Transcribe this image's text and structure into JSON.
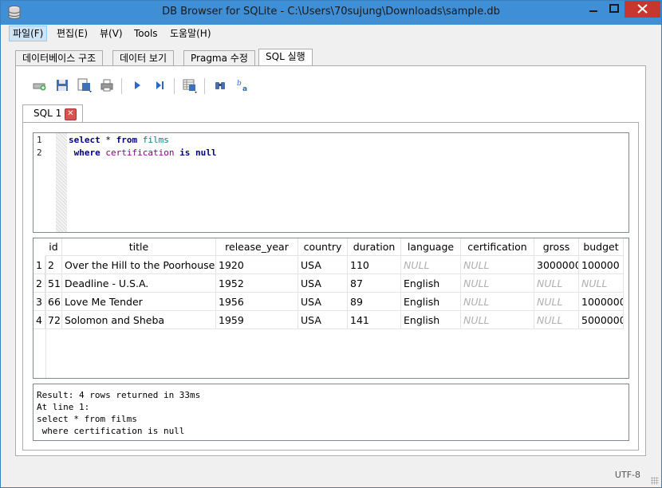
{
  "window": {
    "title": "DB Browser for SQLite - C:\\Users\\70sujung\\Downloads\\sample.db",
    "minimize": "—",
    "maximize": "□",
    "close": "✕"
  },
  "menu": [
    "파일(F)",
    "편집(E)",
    "뷰(V)",
    "Tools",
    "도움말(H)"
  ],
  "tabs": [
    "데이터베이스 구조",
    "데이터 보기",
    "Pragma 수정",
    "SQL 실행"
  ],
  "active_tab": "SQL 실행",
  "toolbar_icons": [
    "open-tab-icon",
    "open-sql-file-icon",
    "save-sql-file-icon",
    "print-icon",
    "execute-all-icon",
    "execute-line-icon",
    "save-results-icon",
    "find-icon",
    "find-replace-icon"
  ],
  "sql_tab": {
    "label": "SQL 1",
    "close": "✕"
  },
  "editor": {
    "line_numbers": [
      "1",
      "2"
    ],
    "lines": [
      [
        {
          "t": "select",
          "c": "kw"
        },
        {
          "t": " * ",
          "c": ""
        },
        {
          "t": "from",
          "c": "kw"
        },
        {
          "t": " ",
          "c": ""
        },
        {
          "t": "films",
          "c": "tbl"
        }
      ],
      [
        {
          "t": " ",
          "c": ""
        },
        {
          "t": "where",
          "c": "kw"
        },
        {
          "t": " ",
          "c": ""
        },
        {
          "t": "certification",
          "c": "col"
        },
        {
          "t": " ",
          "c": ""
        },
        {
          "t": "is",
          "c": "kw"
        },
        {
          "t": " ",
          "c": ""
        },
        {
          "t": "null",
          "c": "kw"
        }
      ]
    ]
  },
  "results": {
    "columns": [
      "id",
      "title",
      "release_year",
      "country",
      "duration",
      "language",
      "certification",
      "gross",
      "budget"
    ],
    "rows": [
      {
        "num": "1",
        "cells": [
          "2",
          "Over the Hill to the Poorhouse",
          "1920",
          "USA",
          "110",
          "NULL",
          "NULL",
          "3000000",
          "100000"
        ]
      },
      {
        "num": "2",
        "cells": [
          "51",
          "Deadline - U.S.A.",
          "1952",
          "USA",
          "87",
          "English",
          "NULL",
          "NULL",
          "NULL"
        ]
      },
      {
        "num": "3",
        "cells": [
          "66",
          "Love Me Tender",
          "1956",
          "USA",
          "89",
          "English",
          "NULL",
          "NULL",
          "1000000"
        ]
      },
      {
        "num": "4",
        "cells": [
          "72",
          "Solomon and Sheba",
          "1959",
          "USA",
          "141",
          "English",
          "NULL",
          "NULL",
          "5000000"
        ]
      }
    ]
  },
  "message": "Result: 4 rows returned in 33ms\nAt line 1:\nselect * from films\n where certification is null",
  "status": {
    "encoding": "UTF-8"
  }
}
